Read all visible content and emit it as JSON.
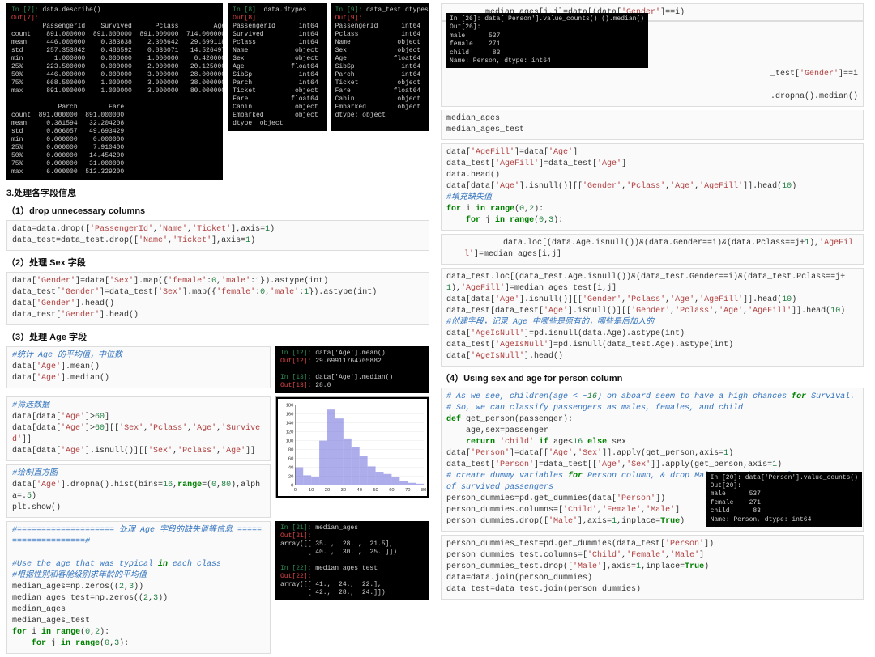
{
  "describe_terminal": "In [7]: data.describe()\nOut[7]:\n        PassengerId    Survived      Pclass         Age       SibSp\ncount    891.000000  891.000000  891.000000  714.000000  891.000000\nmean     446.000000    0.383838    2.308642   29.699118    0.523008\nstd      257.353842    0.486592    0.836071   14.526497    1.102743\nmin        1.000000    0.000000    1.000000    0.420000    0.000000\n25%      223.500000    0.000000    2.000000   20.125000    0.000000\n50%      446.000000    0.000000    3.000000   28.000000    0.000000\n75%      668.500000    1.000000    3.000000   38.000000    1.000000\nmax      891.000000    1.000000    3.000000   80.000000    8.000000\n\n            Parch        Fare\ncount  891.000000  891.000000\nmean     0.381594   32.204208\nstd      0.806057   49.693429\nmin      0.000000    0.000000\n25%      0.000000    7.910400\n50%      0.000000   14.454200\n75%      0.000000   31.000000\nmax      6.000000  512.329200",
  "dtypes_train": "In [8]: data.dtypes\nOut[8]:\nPassengerId      int64\nSurvived         int64\nPclass           int64\nName            object\nSex             object\nAge            float64\nSibSp            int64\nParch            int64\nTicket          object\nFare           float64\nCabin           object\nEmbarked        object\ndtype: object",
  "dtypes_test": "In [9]: data_test.dtypes\nOut[9]:\nPassengerId      int64\nPclass           int64\nName            object\nSex             object\nAge            float64\nSibSp            int64\nParch            int64\nTicket          object\nFare           float64\nCabin           object\nEmbarked        object\ndtype: object",
  "h3": "3.处理各字段信息",
  "s1": "（1）drop unnecessary columns",
  "code_drop": "data=data.drop(['PassengerId','Name','Ticket'],axis=1)\ndata_test=data_test.drop(['Name','Ticket'],axis=1)",
  "s2": "（2）处理 Sex 字段",
  "code_sex": "data['Gender']=data['Sex'].map({'female':0,'male':1}).astype(int)\ndata_test['Gender']=data_test['Sex'].map({'female':0,'male':1}).astype(int)\ndata['Gender'].head()\ndata_test['Gender'].head()",
  "s3": "（3）处理 Age 字段",
  "code_age1": "#统计 Age 的平均值，中位数\ndata['Age'].mean()\ndata['Age'].median()",
  "term_age1": "In [12]: data['Age'].mean()\nOut[12]: 29.69911764705882\n\nIn [13]: data['Age'].median()\nOut[13]: 28.0",
  "code_age2": "#筛选数据\ndata[data['Age']>60]\ndata[data['Age']>60][['Sex','Pclass','Age','Survived']]\ndata[data['Age'].isnull()][['Sex','Pclass','Age']]",
  "code_age3": "#绘制直方图\ndata['Age'].dropna().hist(bins=16,range=(0,80),alpha=.5)\nplt.show()",
  "code_age4": "#==================== 处理 Age 字段的缺失值等信息 ====================#\n\n#Use the age that was typical in each class\n#根据性别和客舱级别求年龄的平均值\nmedian_ages=np.zeros((2,3))\nmedian_ages_test=np.zeros((2,3))\nmedian_ages\nmedian_ages_test\nfor i in range(0,2):\n    for j in range(0,3):",
  "term_age4": "In [21]: median_ages\nOut[21]:\narray([[ 35. ,  28. ,  21.5],\n       [ 40. ,  30. ,  25. ]])\n\nIn [22]: median_ages_test\nOut[22]:\narray([[ 41.,  24.,  22.],\n       [ 42.,  28.,  24.]])",
  "code_r1_top": "        median_ages[i,j]=data[(data['Gender']==i)",
  "term_person_counts": "In [26]: data['Person'].value_counts() ().median()\nOut[26]:\nmale      537\nfemale    271\nchild      83\nName: Person, dtype: int64",
  "code_r1_mid": "_test['Gender']==i\n\n.dropna().median()",
  "code_r1_bot": "median_ages\nmedian_ages_test",
  "code_r2": "data['AgeFill']=data['Age']\ndata_test['AgeFill']=data_test['Age']\ndata.head()\ndata[data['Age'].isnull()][['Gender','Pclass','Age','AgeFill']].head(10)\n#填充缺失值\nfor i in range(0,2):\n    for j in range(0,3):",
  "code_r2b": "        data.loc[(data.Age.isnull())&(data.Gender==i)&(data.Pclass==j+1),'AgeFill']=median_ages[i,j]",
  "code_r3": "data_test.loc[(data_test.Age.isnull())&(data_test.Gender==i)&(data_test.Pclass==j+1),'AgeFill']=median_ages_test[i,j]\ndata[data['Age'].isnull()][['Gender','Pclass','Age','AgeFill']].head(10)\ndata_test[data_test['Age'].isnull()][['Gender','Pclass','Age','AgeFill']].head(10)\n#创建字段，记录 Age 中哪些是原有的，哪些是后加入的\ndata['AgeIsNull']=pd.isnull(data.Age).astype(int)\ndata_test['AgeIsNull']=pd.isnull(data_test.Age).astype(int)\ndata['AgeIsNull'].head()",
  "s4": "（4）Using sex and age for person column",
  "code_r4": "# As we see, children(age < ~16) on aboard seem to have a high chances for Survival.\n# So, we can classify passengers as males, females, and child\ndef get_person(passenger):\n    age,sex=passenger\n    return 'child' if age<16 else sex\ndata['Person']=data[['Age','Sex']].apply(get_person,axis=1)\ndata_test['Person']=data_test[['Age','Sex']].apply(get_person,axis=1)\n# create dummy variables for Person column, & drop Male as it has the lowest average of survived passengers\nperson_dummies=pd.get_dummies(data['Person'])\nperson_dummies.columns=['Child','Female','Male']\nperson_dummies.drop(['Male'],axis=1,inplace=True)",
  "term_person_counts2": "In [20]: data['Person'].value_counts()\nOut[20]:\nmale      537\nfemale    271\nchild      83\nName: Person, dtype: int64",
  "code_r5": "person_dummies_test=pd.get_dummies(data_test['Person'])\nperson_dummies_test.columns=['Child','Female','Male']\nperson_dummies_test.drop(['Male'],axis=1,inplace=True)\ndata=data.join(person_dummies)\ndata_test=data_test.join(person_dummies)",
  "chart_data": {
    "type": "bar",
    "title": "",
    "xlabel": "",
    "ylabel": "",
    "x_range": [
      0,
      80
    ],
    "x_ticks": [
      0,
      10,
      20,
      30,
      40,
      50,
      60,
      70,
      80
    ],
    "y_range": [
      0,
      180
    ],
    "y_ticks": [
      0,
      20,
      40,
      60,
      80,
      100,
      120,
      140,
      160,
      180
    ],
    "bins": [
      [
        0,
        5
      ],
      [
        5,
        10
      ],
      [
        10,
        15
      ],
      [
        15,
        20
      ],
      [
        20,
        25
      ],
      [
        25,
        30
      ],
      [
        30,
        35
      ],
      [
        35,
        40
      ],
      [
        40,
        45
      ],
      [
        45,
        50
      ],
      [
        50,
        55
      ],
      [
        55,
        60
      ],
      [
        60,
        65
      ],
      [
        65,
        70
      ],
      [
        70,
        75
      ],
      [
        75,
        80
      ]
    ],
    "values": [
      40,
      22,
      18,
      100,
      170,
      150,
      105,
      85,
      65,
      42,
      30,
      25,
      18,
      10,
      5,
      3
    ]
  }
}
